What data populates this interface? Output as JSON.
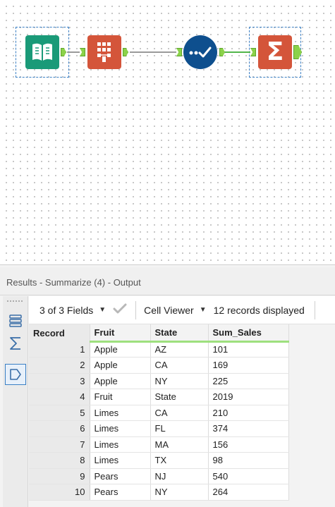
{
  "workflow": {
    "tools": [
      {
        "name": "input-data-tool",
        "icon": "book-icon",
        "color": "#1a9a78"
      },
      {
        "name": "select-tool",
        "icon": "grid-select-icon",
        "color": "#d4553a"
      },
      {
        "name": "browse-or-dots-tool",
        "icon": "dots-check-icon",
        "color": "#0e4f8e"
      },
      {
        "name": "summarize-tool",
        "icon": "sigma-icon",
        "color": "#d4553a",
        "glyph": "Σ"
      }
    ]
  },
  "results": {
    "title": "Results - Summarize (4) - Output",
    "toolbar": {
      "fields_label": "3 of 3 Fields",
      "viewer_label": "Cell Viewer",
      "records_label": "12 records displayed"
    },
    "table": {
      "columns": [
        "Record",
        "Fruit",
        "State",
        "Sum_Sales"
      ],
      "rows": [
        [
          "1",
          "Apple",
          "AZ",
          "101"
        ],
        [
          "2",
          "Apple",
          "CA",
          "169"
        ],
        [
          "3",
          "Apple",
          "NY",
          "225"
        ],
        [
          "4",
          "Fruit",
          "State",
          "2019"
        ],
        [
          "5",
          "Limes",
          "CA",
          "210"
        ],
        [
          "6",
          "Limes",
          "FL",
          "374"
        ],
        [
          "7",
          "Limes",
          "MA",
          "156"
        ],
        [
          "8",
          "Limes",
          "TX",
          "98"
        ],
        [
          "9",
          "Pears",
          "NJ",
          "540"
        ],
        [
          "10",
          "Pears",
          "NY",
          "264"
        ]
      ]
    }
  }
}
